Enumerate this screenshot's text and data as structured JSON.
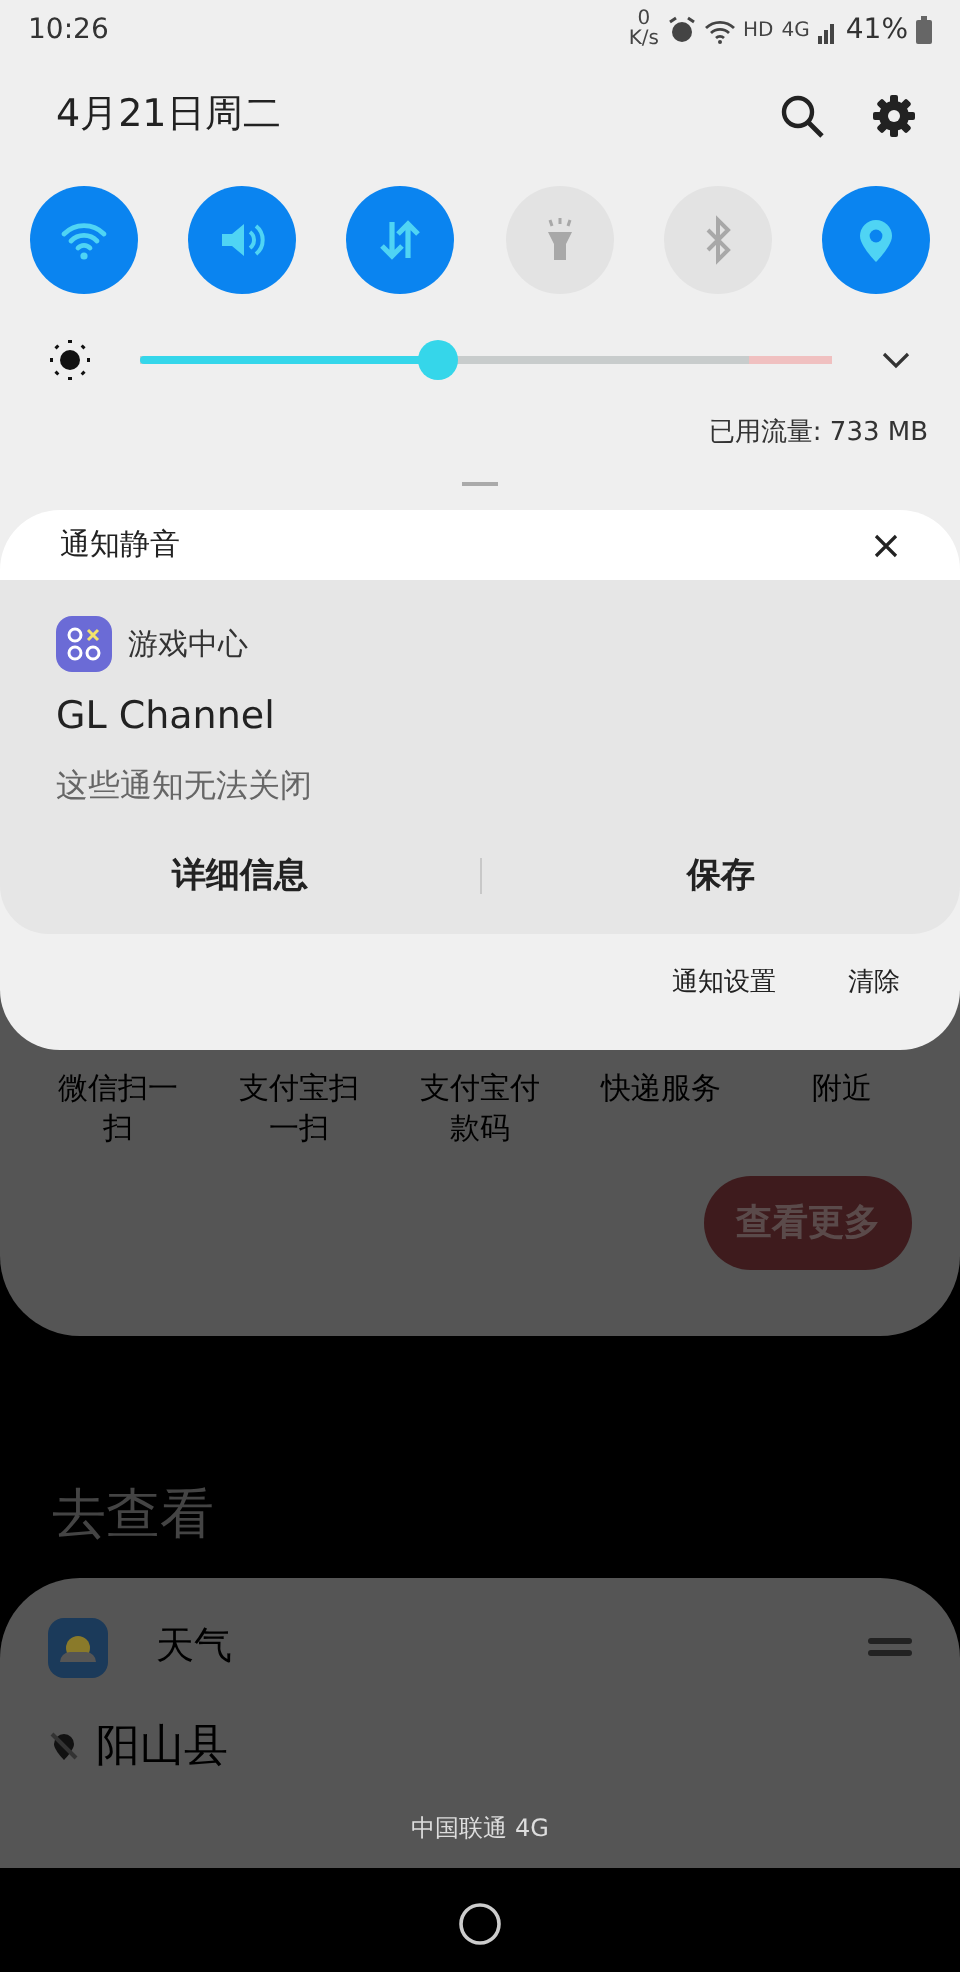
{
  "status_bar": {
    "time": "10:26",
    "net_speed_value": "0",
    "net_speed_unit": "K/s",
    "hd": "HD",
    "network": "4G",
    "battery": "41%"
  },
  "quick_panel": {
    "date": "4月21日周二",
    "toggles": [
      {
        "kind": "wifi",
        "on": true
      },
      {
        "kind": "sound",
        "on": true
      },
      {
        "kind": "data",
        "on": true
      },
      {
        "kind": "flashlight",
        "on": false
      },
      {
        "kind": "bluetooth",
        "on": false
      },
      {
        "kind": "location",
        "on": true
      }
    ],
    "brightness": {
      "level": 0.43
    },
    "data_usage": "已用流量: 733 MB"
  },
  "notification_card": {
    "title": "通知静音",
    "app_name": "游戏中心",
    "channel": "GL Channel",
    "message": "这些通知无法关闭",
    "actions": [
      "详细信息",
      "保存"
    ],
    "footer_buttons": [
      "通知设置",
      "清除"
    ]
  },
  "background": {
    "shortcuts": [
      "微信扫一扫",
      "支付宝扫一扫",
      "支付宝付款码",
      "快递服务",
      "附近"
    ],
    "more_button": "查看更多",
    "section_title": "去查看",
    "weather_card": {
      "title": "天气",
      "location": "阳山县"
    }
  },
  "carrier": "中国联通 4G"
}
